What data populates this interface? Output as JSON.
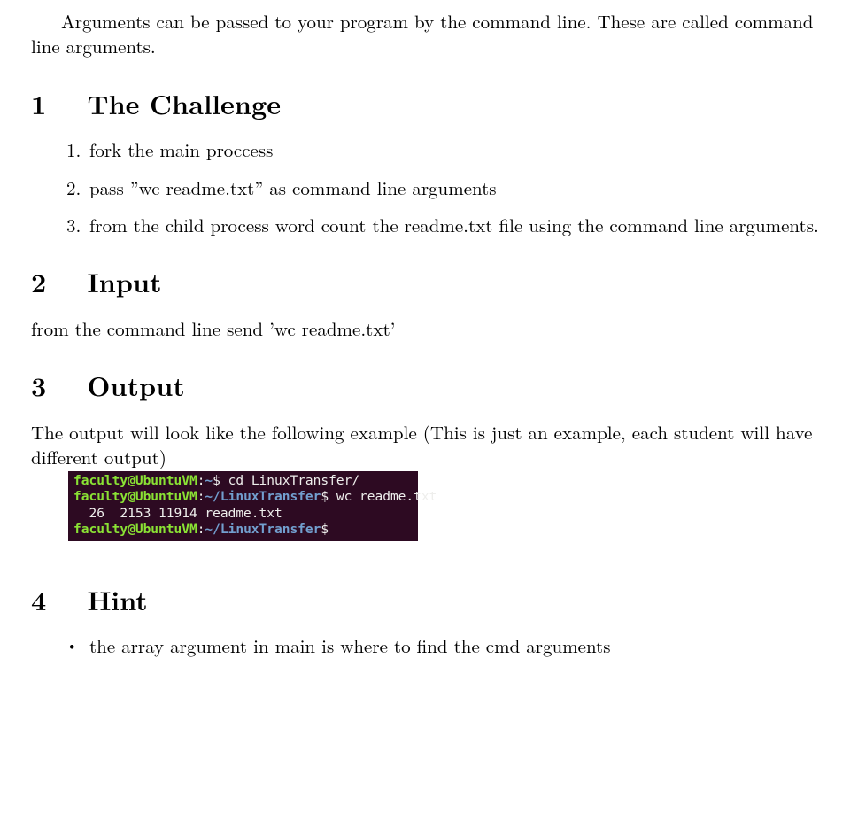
{
  "intro": "Arguments can be passed to your program by the command line. These are called command line arguments.",
  "sections": {
    "challenge": {
      "num": "1",
      "title": "The Challenge",
      "items": [
        "fork the main proccess",
        "pass ”wc readme.txt” as command line arguments",
        "from the child process word count the readme.txt file using the command line arguments."
      ]
    },
    "input": {
      "num": "2",
      "title": "Input",
      "text": "from the command line send ’wc readme.txt’"
    },
    "output": {
      "num": "3",
      "title": "Output",
      "text": "The output will look like the following example (This is just an example, each student will have different output)",
      "terminal": {
        "lines": [
          {
            "userhost": "faculty@UbuntuVM",
            "colon": ":",
            "path": "~",
            "dollar": "$ ",
            "cmd": "cd LinuxTransfer/"
          },
          {
            "userhost": "faculty@UbuntuVM",
            "colon": ":",
            "path": "~/LinuxTransfer",
            "dollar": "$ ",
            "cmd": "wc readme.txt"
          },
          {
            "plain": "  26  2153 11914 readme.txt"
          },
          {
            "userhost": "faculty@UbuntuVM",
            "colon": ":",
            "path": "~/LinuxTransfer",
            "dollar": "$",
            "cmd": ""
          }
        ]
      }
    },
    "hint": {
      "num": "4",
      "title": "Hint",
      "items": [
        "the array argument in main is where to find the cmd arguments"
      ]
    }
  }
}
